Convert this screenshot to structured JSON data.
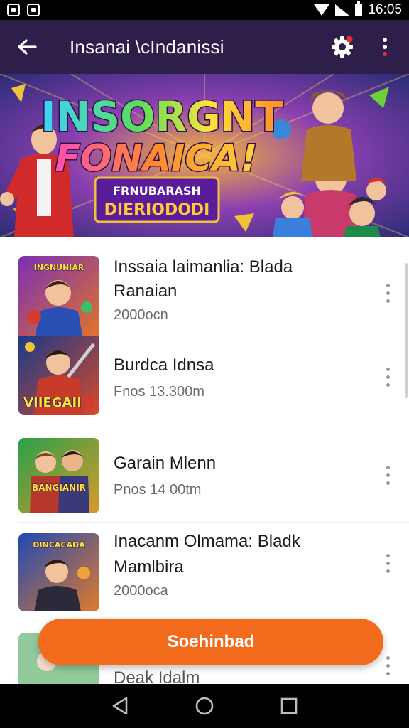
{
  "status_bar": {
    "time": "16:05"
  },
  "app_bar": {
    "title": "Insanai \\cIndanissi"
  },
  "banner": {
    "headline_line1": "INSORGNT",
    "headline_line2": "FONAICA!",
    "tagline_line1": "FRNUBARASH",
    "tagline_line2": "DIERIODODI"
  },
  "items": [
    {
      "title_line1": "Inssaia laimanlia: Blada",
      "title_line2": "Ranaian",
      "subtitle": "2000ocn",
      "thumb_text": "INGNUNIAR"
    },
    {
      "title_line1": "Burdca Idnsa",
      "subtitle": "Fnos 13.300m",
      "thumb_text": "VIIEGAII"
    },
    {
      "title_line1": "Garain Mlenn",
      "subtitle": "Pnos 14 00tm",
      "thumb_text": "BANGIANIR"
    },
    {
      "title_line1": "Inacanm Olmama: Bladk",
      "title_line2": "Mamlbira",
      "subtitle": "2000oca",
      "thumb_text": "DINCACADA"
    }
  ],
  "partial_item": {
    "title_line1": "Deak Idalm"
  },
  "download_button": {
    "label": "Soehinbad"
  },
  "colors": {
    "app_bar": "#2d1e4a",
    "accent": "#f26a1b",
    "status_bar": "#000000"
  }
}
